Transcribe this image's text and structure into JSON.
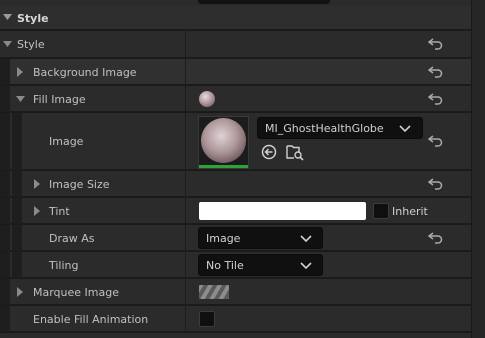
{
  "colors": {
    "panel_bg": "#2b2b2b",
    "section_bg": "#2e2e2e",
    "input_bg": "#101010",
    "accent_green": "#2fa33a",
    "text": "#c0c0c0"
  },
  "categories": {
    "style_header": "Style",
    "style_sub": "Style"
  },
  "rows": {
    "background_image": "Background Image",
    "fill_image": "Fill Image",
    "image": "Image",
    "image_size": "Image Size",
    "tint": "Tint",
    "draw_as": "Draw As",
    "tiling": "Tiling",
    "marquee_image": "Marquee Image",
    "enable_fill_animation": "Enable Fill Animation"
  },
  "image_asset": {
    "name": "MI_GhostHealthGlobe",
    "browse_icon": "use-selected-asset-icon",
    "find_icon": "browse-to-asset-icon"
  },
  "tint": {
    "color": "#ffffff",
    "inherit_label": "Inherit",
    "inherit_checked": false
  },
  "draw_as": {
    "selected": "Image"
  },
  "tiling": {
    "selected": "No Tile"
  },
  "enable_fill_animation": {
    "checked": false
  }
}
